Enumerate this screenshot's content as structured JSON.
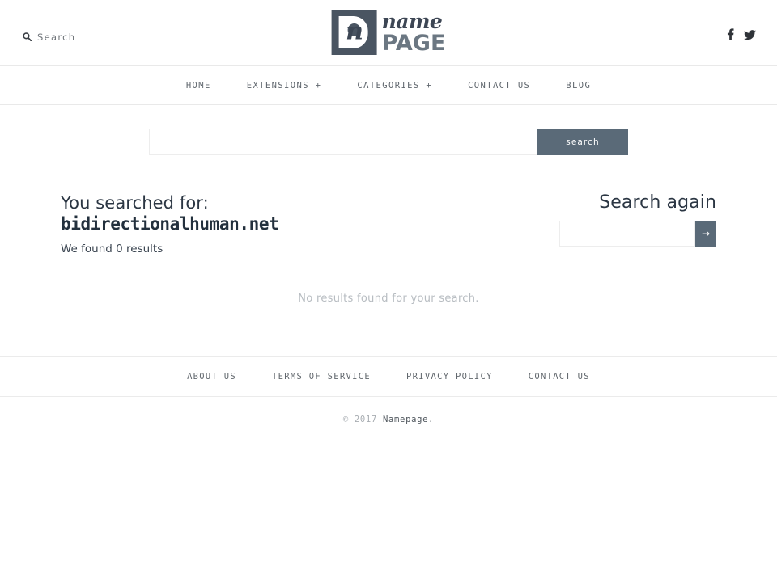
{
  "header": {
    "search_link_label": "Search",
    "search_icon": "magnifier-icon",
    "logo": {
      "mark_letter": "n",
      "script_text": "name",
      "bold_text": "PAGE"
    },
    "social": [
      {
        "name": "facebook-icon",
        "glyph": "f"
      },
      {
        "name": "twitter-icon",
        "glyph": "bird"
      }
    ]
  },
  "nav": {
    "items": [
      {
        "label": "HOME"
      },
      {
        "label": "EXTENSIONS +"
      },
      {
        "label": "CATEGORIES +"
      },
      {
        "label": "CONTACT US"
      },
      {
        "label": "BLOG"
      }
    ]
  },
  "search_form": {
    "value": "",
    "placeholder": "",
    "submit_label": "search"
  },
  "results": {
    "searched_for_label": "You searched for:",
    "query": "bidirectionalhuman.net",
    "found_text": "We found 0 results",
    "empty_message": "No results found for your search.",
    "search_again": {
      "title": "Search again",
      "value": "",
      "placeholder": "",
      "submit_glyph": "→"
    }
  },
  "footer": {
    "links": [
      {
        "label": "ABOUT US"
      },
      {
        "label": "TERMS OF SERVICE"
      },
      {
        "label": "PRIVACY POLICY"
      },
      {
        "label": "CONTACT US"
      }
    ],
    "copyright_year": "© 2017",
    "copyright_name": "Namepage."
  },
  "colors": {
    "accent": "#5a6a78",
    "logo_mark": "#4a5562",
    "heading": "#2b3643",
    "muted": "#b7bcc1",
    "rule": "#e9e9e9"
  }
}
